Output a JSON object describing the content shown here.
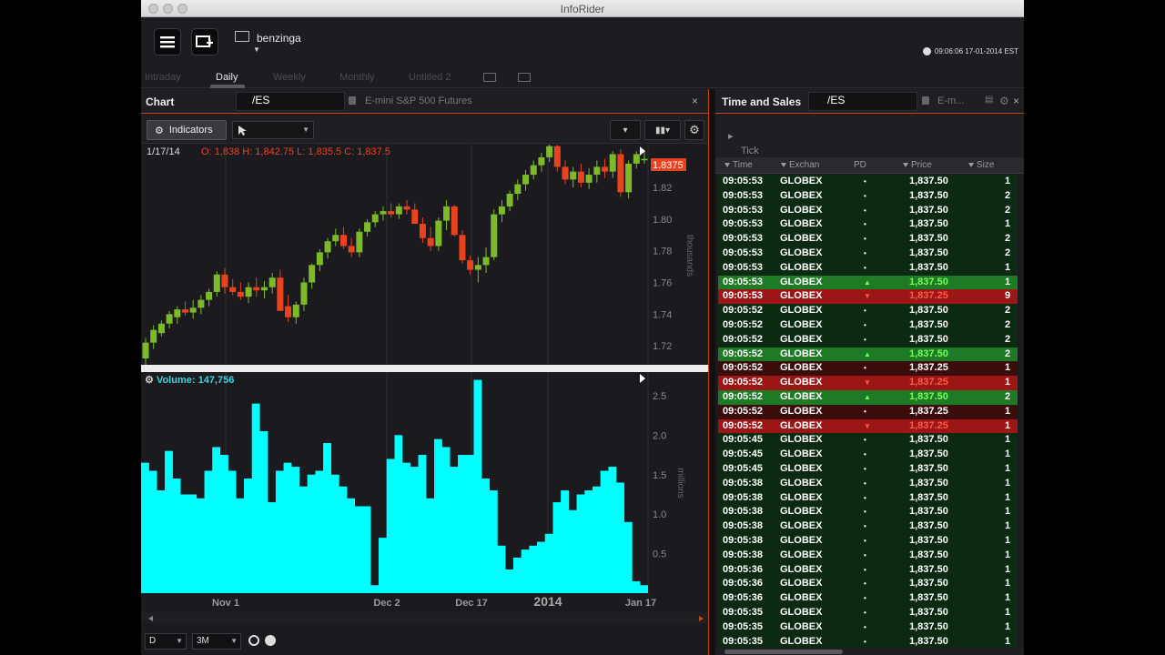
{
  "window": {
    "title": "InfoRider"
  },
  "toolbar": {
    "workspace_name": "benzinga",
    "clock": "09:06:06 17-01-2014 EST"
  },
  "tabs": [
    {
      "label": "Intraday",
      "active": false
    },
    {
      "label": "Daily",
      "active": true
    },
    {
      "label": "Weekly",
      "active": false
    },
    {
      "label": "Monthly",
      "active": false
    },
    {
      "label": "Untitled 2",
      "active": false
    }
  ],
  "chart_panel": {
    "title": "Chart",
    "symbol": "/ES",
    "description": "E-mini S&P 500 Futures",
    "indicators_label": "Indicators",
    "ohlc_date": "1/17/14",
    "ohlc_values": "O: 1,838 H: 1,842.75 L: 1,835.5 C: 1,837.5",
    "last_price_tag": "1.8375",
    "price_axis_unit": "thousands",
    "volume_label": "Volume:",
    "volume_value": "147,756",
    "volume_axis_unit": "millions",
    "interval_select": "D",
    "range_select": "3M"
  },
  "chart_data": [
    {
      "type": "candlestick",
      "x_tick_labels": [
        "Nov 1",
        "Dec 2",
        "Dec 17",
        "2014",
        "Jan 17"
      ],
      "y_tick_labels": [
        "1.82",
        "1.80",
        "1.78",
        "1.76",
        "1.74",
        "1.72"
      ],
      "ylabel": "thousands",
      "ylim": [
        1.708,
        1.847
      ],
      "grid": true,
      "colors": {
        "up": "#7dba2a",
        "down": "#e8421f"
      },
      "candles": [
        [
          1.712,
          1.725,
          1.708,
          1.722
        ],
        [
          1.722,
          1.733,
          1.718,
          1.73
        ],
        [
          1.728,
          1.736,
          1.726,
          1.734
        ],
        [
          1.734,
          1.742,
          1.731,
          1.74
        ],
        [
          1.738,
          1.745,
          1.734,
          1.743
        ],
        [
          1.743,
          1.748,
          1.739,
          1.741
        ],
        [
          1.741,
          1.749,
          1.737,
          1.744
        ],
        [
          1.744,
          1.752,
          1.74,
          1.749
        ],
        [
          1.749,
          1.756,
          1.745,
          1.754
        ],
        [
          1.754,
          1.767,
          1.751,
          1.765
        ],
        [
          1.765,
          1.769,
          1.753,
          1.757
        ],
        [
          1.757,
          1.762,
          1.752,
          1.754
        ],
        [
          1.754,
          1.76,
          1.749,
          1.751
        ],
        [
          1.751,
          1.76,
          1.747,
          1.757
        ],
        [
          1.757,
          1.763,
          1.751,
          1.755
        ],
        [
          1.755,
          1.761,
          1.75,
          1.757
        ],
        [
          1.757,
          1.766,
          1.753,
          1.763
        ],
        [
          1.763,
          1.768,
          1.747,
          1.742
        ],
        [
          1.745,
          1.752,
          1.735,
          1.738
        ],
        [
          1.738,
          1.748,
          1.734,
          1.746
        ],
        [
          1.746,
          1.763,
          1.742,
          1.76
        ],
        [
          1.76,
          1.772,
          1.756,
          1.771
        ],
        [
          1.771,
          1.781,
          1.767,
          1.779
        ],
        [
          1.779,
          1.788,
          1.775,
          1.786
        ],
        [
          1.786,
          1.794,
          1.783,
          1.79
        ],
        [
          1.79,
          1.795,
          1.781,
          1.783
        ],
        [
          1.783,
          1.788,
          1.776,
          1.779
        ],
        [
          1.779,
          1.794,
          1.776,
          1.792
        ],
        [
          1.792,
          1.8,
          1.789,
          1.798
        ],
        [
          1.798,
          1.805,
          1.795,
          1.803
        ],
        [
          1.803,
          1.808,
          1.799,
          1.805
        ],
        [
          1.805,
          1.81,
          1.801,
          1.803
        ],
        [
          1.803,
          1.81,
          1.8,
          1.808
        ],
        [
          1.808,
          1.812,
          1.803,
          1.806
        ],
        [
          1.806,
          1.81,
          1.801,
          1.797
        ],
        [
          1.797,
          1.801,
          1.785,
          1.788
        ],
        [
          1.788,
          1.795,
          1.78,
          1.783
        ],
        [
          1.783,
          1.801,
          1.78,
          1.799
        ],
        [
          1.799,
          1.812,
          1.793,
          1.808
        ],
        [
          1.808,
          1.809,
          1.789,
          1.79
        ],
        [
          1.79,
          1.793,
          1.772,
          1.774
        ],
        [
          1.774,
          1.777,
          1.765,
          1.768
        ],
        [
          1.768,
          1.776,
          1.76,
          1.771
        ],
        [
          1.771,
          1.782,
          1.766,
          1.776
        ],
        [
          1.776,
          1.806,
          1.774,
          1.803
        ],
        [
          1.803,
          1.812,
          1.798,
          1.808
        ],
        [
          1.808,
          1.818,
          1.805,
          1.816
        ],
        [
          1.816,
          1.825,
          1.812,
          1.822
        ],
        [
          1.822,
          1.831,
          1.818,
          1.828
        ],
        [
          1.828,
          1.837,
          1.825,
          1.834
        ],
        [
          1.834,
          1.842,
          1.83,
          1.839
        ],
        [
          1.839,
          1.848,
          1.836,
          1.846
        ],
        [
          1.846,
          1.847,
          1.83,
          1.833
        ],
        [
          1.833,
          1.837,
          1.822,
          1.825
        ],
        [
          1.825,
          1.833,
          1.82,
          1.83
        ],
        [
          1.83,
          1.835,
          1.82,
          1.823
        ],
        [
          1.823,
          1.832,
          1.819,
          1.828
        ],
        [
          1.828,
          1.837,
          1.823,
          1.833
        ],
        [
          1.833,
          1.838,
          1.826,
          1.83
        ],
        [
          1.83,
          1.843,
          1.826,
          1.841
        ],
        [
          1.841,
          1.844,
          1.814,
          1.817
        ],
        [
          1.817,
          1.837,
          1.813,
          1.835
        ],
        [
          1.835,
          1.843,
          1.832,
          1.841
        ],
        [
          1.838,
          1.843,
          1.835,
          1.838
        ]
      ]
    },
    {
      "type": "bar",
      "series": [
        {
          "name": "Volume",
          "values": [
            1.65,
            1.55,
            1.3,
            1.8,
            1.45,
            1.25,
            1.25,
            1.2,
            1.55,
            1.85,
            1.75,
            1.55,
            1.2,
            1.45,
            2.4,
            2.05,
            1.15,
            1.55,
            1.65,
            1.6,
            1.35,
            1.5,
            1.55,
            1.9,
            1.5,
            1.35,
            1.2,
            1.1,
            1.1,
            0.1,
            0.7,
            1.7,
            2.0,
            1.65,
            1.6,
            1.75,
            1.2,
            1.95,
            1.85,
            1.6,
            1.75,
            1.75,
            2.7,
            1.45,
            1.3,
            0.6,
            0.3,
            0.45,
            0.55,
            0.6,
            0.65,
            0.75,
            1.15,
            1.3,
            1.05,
            1.25,
            1.3,
            1.35,
            1.55,
            1.6,
            1.4,
            0.9,
            0.15,
            0.1
          ]
        }
      ],
      "y_tick_labels": [
        "2.5",
        "2.0",
        "1.5",
        "1.0",
        "0.5"
      ],
      "ylabel": "millions",
      "ylim": [
        0,
        2.8
      ],
      "colors": {
        "bar": "#00ffff"
      }
    }
  ],
  "time_and_sales": {
    "title": "Time and Sales",
    "symbol": "/ES",
    "description": "E-m...",
    "tick_chart_label": "Tick Chart",
    "columns": [
      "Time",
      "Exchan",
      "PD",
      "Price",
      "Size"
    ],
    "rows": [
      [
        "09:05:53",
        "GLOBEX",
        "•",
        "1,837.50",
        "1",
        "n"
      ],
      [
        "09:05:53",
        "GLOBEX",
        "•",
        "1,837.50",
        "2",
        "n"
      ],
      [
        "09:05:53",
        "GLOBEX",
        "•",
        "1,837.50",
        "2",
        "n"
      ],
      [
        "09:05:53",
        "GLOBEX",
        "•",
        "1,837.50",
        "1",
        "n"
      ],
      [
        "09:05:53",
        "GLOBEX",
        "•",
        "1,837.50",
        "2",
        "n"
      ],
      [
        "09:05:53",
        "GLOBEX",
        "•",
        "1,837.50",
        "2",
        "n"
      ],
      [
        "09:05:53",
        "GLOBEX",
        "•",
        "1,837.50",
        "1",
        "n"
      ],
      [
        "09:05:53",
        "GLOBEX",
        "▲",
        "1,837.50",
        "1",
        "u"
      ],
      [
        "09:05:53",
        "GLOBEX",
        "▼",
        "1,837.25",
        "9",
        "d"
      ],
      [
        "09:05:52",
        "GLOBEX",
        "•",
        "1,837.50",
        "2",
        "n"
      ],
      [
        "09:05:52",
        "GLOBEX",
        "•",
        "1,837.50",
        "2",
        "n"
      ],
      [
        "09:05:52",
        "GLOBEX",
        "•",
        "1,837.50",
        "2",
        "n"
      ],
      [
        "09:05:52",
        "GLOBEX",
        "▲",
        "1,837.50",
        "2",
        "u"
      ],
      [
        "09:05:52",
        "GLOBEX",
        "•",
        "1,837.25",
        "1",
        "e"
      ],
      [
        "09:05:52",
        "GLOBEX",
        "▼",
        "1,837.25",
        "1",
        "d"
      ],
      [
        "09:05:52",
        "GLOBEX",
        "▲",
        "1,837.50",
        "2",
        "u"
      ],
      [
        "09:05:52",
        "GLOBEX",
        "•",
        "1,837.25",
        "1",
        "e"
      ],
      [
        "09:05:52",
        "GLOBEX",
        "▼",
        "1,837.25",
        "1",
        "d"
      ],
      [
        "09:05:45",
        "GLOBEX",
        "•",
        "1,837.50",
        "1",
        "n"
      ],
      [
        "09:05:45",
        "GLOBEX",
        "•",
        "1,837.50",
        "1",
        "n"
      ],
      [
        "09:05:45",
        "GLOBEX",
        "•",
        "1,837.50",
        "1",
        "n"
      ],
      [
        "09:05:38",
        "GLOBEX",
        "•",
        "1,837.50",
        "1",
        "n"
      ],
      [
        "09:05:38",
        "GLOBEX",
        "•",
        "1,837.50",
        "1",
        "n"
      ],
      [
        "09:05:38",
        "GLOBEX",
        "•",
        "1,837.50",
        "1",
        "n"
      ],
      [
        "09:05:38",
        "GLOBEX",
        "•",
        "1,837.50",
        "1",
        "n"
      ],
      [
        "09:05:38",
        "GLOBEX",
        "•",
        "1,837.50",
        "1",
        "n"
      ],
      [
        "09:05:38",
        "GLOBEX",
        "•",
        "1,837.50",
        "1",
        "n"
      ],
      [
        "09:05:36",
        "GLOBEX",
        "•",
        "1,837.50",
        "1",
        "n"
      ],
      [
        "09:05:36",
        "GLOBEX",
        "•",
        "1,837.50",
        "1",
        "n"
      ],
      [
        "09:05:36",
        "GLOBEX",
        "•",
        "1,837.50",
        "1",
        "n"
      ],
      [
        "09:05:35",
        "GLOBEX",
        "•",
        "1,837.50",
        "1",
        "n"
      ],
      [
        "09:05:35",
        "GLOBEX",
        "•",
        "1,837.50",
        "1",
        "n"
      ],
      [
        "09:05:35",
        "GLOBEX",
        "•",
        "1,837.50",
        "1",
        "n"
      ]
    ]
  }
}
